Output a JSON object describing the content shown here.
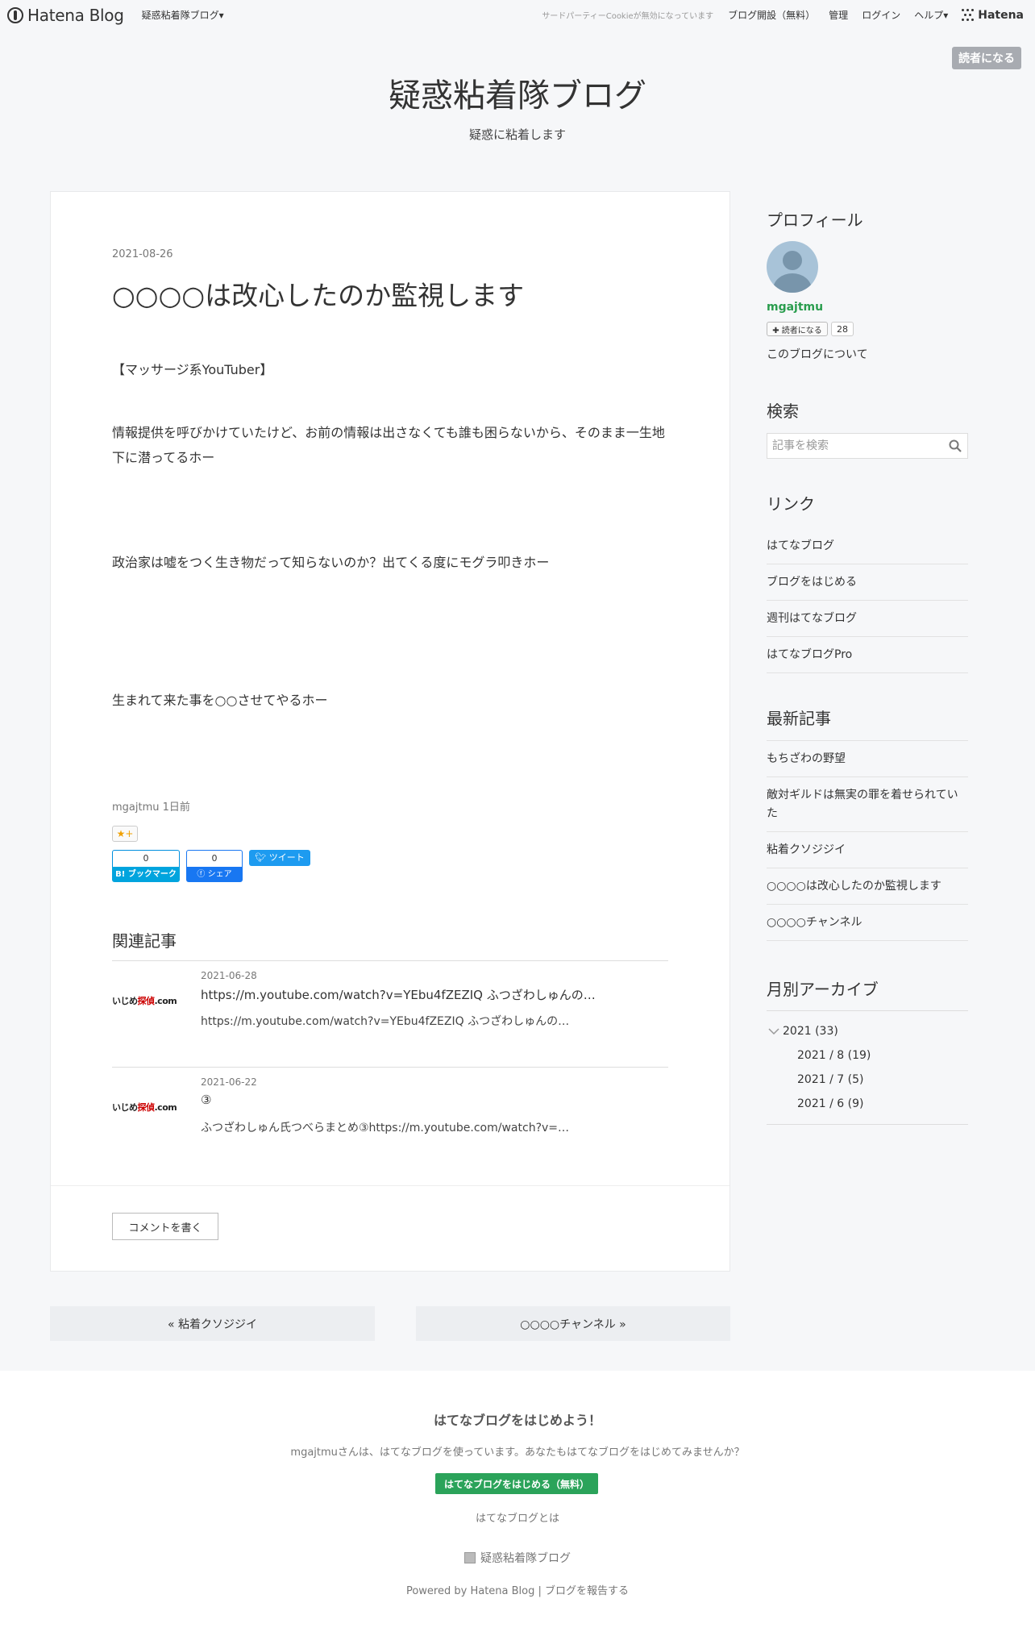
{
  "header": {
    "logo_text": "Hatena Blog",
    "blog_menu": "疑惑粘着隊ブログ▾",
    "cookie_notice": "サードパーティーCookieが無効になっています",
    "links": [
      "ブログ開設（無料）",
      "管理",
      "ログイン",
      "ヘルプ▾"
    ],
    "brand": "Hatena",
    "reader_button": "読者になる"
  },
  "blog": {
    "title": "疑惑粘着隊ブログ",
    "description": "疑惑に粘着します"
  },
  "entry": {
    "date": "2021-08-26",
    "title": "○○○○は改心したのか監視します",
    "paragraphs": [
      "【マッサージ系YouTuber】",
      "情報提供を呼びかけていたけど、お前の情報は出さなくても誰も困らないから、そのまま一生地下に潜ってるホー",
      "政治家は嘘をつく生き物だって知らないのか？出てくる度にモグラ叩きホー",
      "生まれて来た事を○○させてやるホー"
    ],
    "author_line": "mgajtmu 1日前",
    "star_label": "★+",
    "bookmark_count": "0",
    "bookmark_label": "B! ブックマーク",
    "facebook_count": "0",
    "facebook_label": "ⓕ シェア",
    "tweet_label": "ツイート",
    "related_heading": "関連記事",
    "related": [
      {
        "date": "2021-06-28",
        "title": "https://m.youtube.com/watch?v=YEbu4fZEZIQ ふつざわしゅんの…",
        "snippet": "https://m.youtube.com/watch?v=YEbu4fZEZIQ ふつざわしゅんの…",
        "thumb_a": "いじめ",
        "thumb_b": "探偵",
        "thumb_c": ".com"
      },
      {
        "date": "2021-06-22",
        "title": "③",
        "snippet": "ふつざわしゅん氏つべらまとめ③https://m.youtube.com/watch?v=…",
        "thumb_a": "いじめ",
        "thumb_b": "探偵",
        "thumb_c": ".com"
      }
    ],
    "comment_button": "コメントを書く"
  },
  "pager": {
    "prev": "« 粘着クソジジイ",
    "next": "○○○○チャンネル »"
  },
  "sidebar": {
    "profile_title": "プロフィール",
    "username": "mgajtmu",
    "follow_button": "✚ 読者になる",
    "follow_count": "28",
    "about_link": "このブログについて",
    "search_title": "検索",
    "search_placeholder": "記事を検索",
    "links_title": "リンク",
    "links": [
      "はてなブログ",
      "ブログをはじめる",
      "週刊はてなブログ",
      "はてなブログPro"
    ],
    "recent_title": "最新記事",
    "recent": [
      "もちざわの野望",
      "敵対ギルドは無実の罪を着せられていた",
      "粘着クソジジイ",
      "○○○○は改心したのか監視します",
      "○○○○チャンネル"
    ],
    "archive_title": "月別アーカイブ",
    "archive_year": "2021 (33)",
    "archive_months": [
      "2021 / 8 (19)",
      "2021 / 7 (5)",
      "2021 / 6 (9)"
    ]
  },
  "footer": {
    "title": "はてなブログをはじめよう！",
    "desc": "mgajtmuさんは、はてなブログを使っています。あなたもはてなブログをはじめてみませんか？",
    "start_button": "はてなブログをはじめる（無料）",
    "about": "はてなブログとは",
    "blog_name": "疑惑粘着隊ブログ",
    "powered": "Powered by Hatena Blog | ブログを報告する"
  },
  "colors": {
    "accent_green": "#2ba35a",
    "username_green": "#2a9d4e",
    "reader_button_bg": "#a8abb1"
  }
}
